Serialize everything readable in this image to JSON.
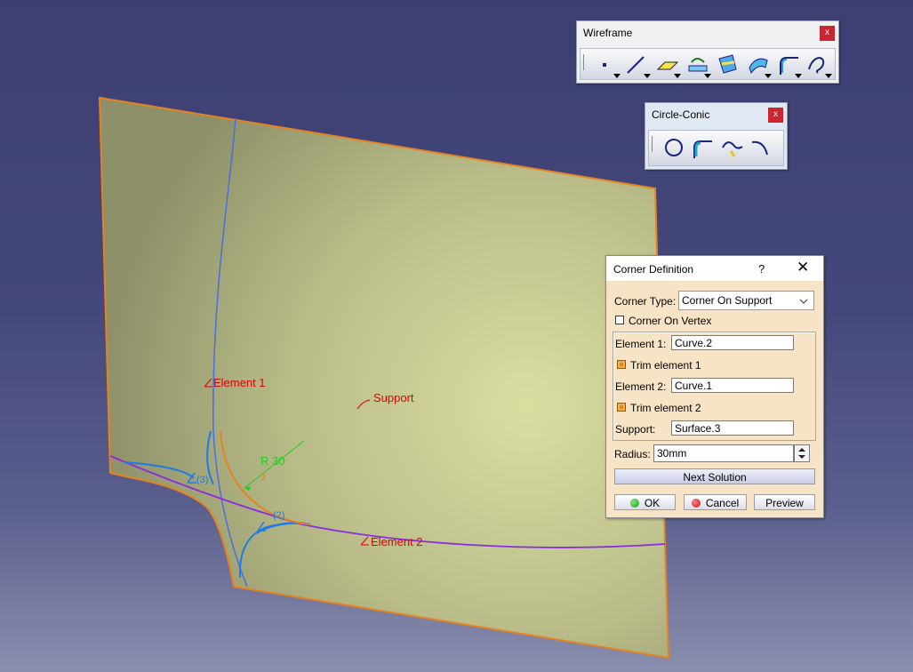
{
  "toolbars": {
    "wireframe": {
      "title": "Wireframe",
      "close": "x",
      "tools": [
        "point-icon",
        "line-icon",
        "plane-icon",
        "projection-icon",
        "intersection-icon",
        "offset-icon",
        "corner-icon",
        "spline-icon"
      ]
    },
    "circle_conic": {
      "title": "Circle-Conic",
      "close": "x",
      "tools": [
        "circle-icon",
        "corner-icon",
        "connect-curve-icon",
        "conic-icon"
      ]
    }
  },
  "scene": {
    "labels": {
      "element1": "Element 1",
      "element2": "Element 2",
      "support": "Support",
      "radius": "R 30",
      "sol3": "(3)",
      "sol2": "(2)",
      "sol1": "1"
    },
    "colors": {
      "background": "#3d3f73",
      "surface": "#c4c793",
      "surface_edge": "#e8821e",
      "curve1": "#4a6de0",
      "curve2": "#8a2be2",
      "corner_current": "#e8821e",
      "corner_solutions": "#1e7be8",
      "label_red": "#e00000",
      "label_green": "#22cc22"
    }
  },
  "dialog": {
    "title": "Corner Definition",
    "help": "?",
    "close": "✕",
    "corner_type_label": "Corner Type:",
    "corner_type_value": "Corner On Support",
    "corner_on_vertex_label": "Corner On Vertex",
    "corner_on_vertex_checked": false,
    "element1_label": "Element 1:",
    "element1_value": "Curve.2",
    "trim1_label": "Trim element 1",
    "trim1_checked": true,
    "element2_label": "Element 2:",
    "element2_value": "Curve.1",
    "trim2_label": "Trim element 2",
    "trim2_checked": true,
    "support_label": "Support:",
    "support_value": "Surface.3",
    "radius_label": "Radius:",
    "radius_value": "30mm",
    "next_solution": "Next Solution",
    "ok": "OK",
    "cancel": "Cancel",
    "preview": "Preview",
    "colors": {
      "ok_dot": "#1a9a1a",
      "cancel_dot": "#d01818"
    }
  }
}
